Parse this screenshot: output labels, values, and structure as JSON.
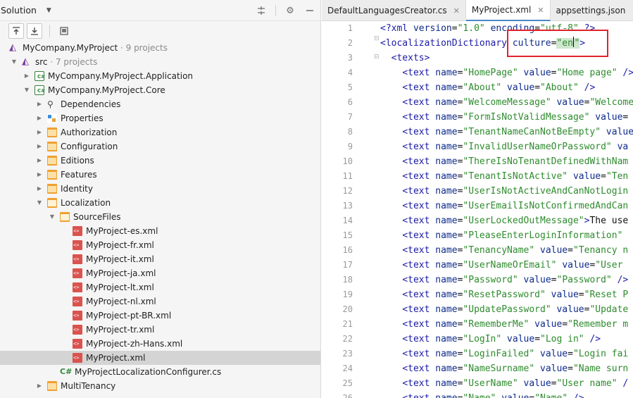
{
  "solution_panel": {
    "title": "Solution",
    "header_icons": [
      "collapse-all-icon",
      "gear-icon",
      "minimize-icon"
    ],
    "toolbar_icons": [
      "sort-up-icon",
      "sort-down-icon",
      "preview-icon"
    ]
  },
  "tree": [
    {
      "label": "MyCompany.MyProject",
      "sub": " · 9 projects",
      "icon": "solution-icon",
      "indent": 0,
      "arrow": ""
    },
    {
      "label": "src",
      "sub": " · 7 projects",
      "icon": "solution-folder-icon",
      "indent": 1,
      "arrow": "down"
    },
    {
      "label": "MyCompany.MyProject.Application",
      "sub": "",
      "icon": "csharp-project-icon",
      "indent": 2,
      "arrow": "right"
    },
    {
      "label": "MyCompany.MyProject.Core",
      "sub": "",
      "icon": "csharp-project-icon",
      "indent": 2,
      "arrow": "down"
    },
    {
      "label": "Dependencies",
      "sub": "",
      "icon": "dependencies-icon",
      "indent": 3,
      "arrow": "right"
    },
    {
      "label": "Properties",
      "sub": "",
      "icon": "properties-icon",
      "indent": 3,
      "arrow": "right"
    },
    {
      "label": "Authorization",
      "sub": "",
      "icon": "folder-icon",
      "indent": 3,
      "arrow": "right"
    },
    {
      "label": "Configuration",
      "sub": "",
      "icon": "folder-icon",
      "indent": 3,
      "arrow": "right"
    },
    {
      "label": "Editions",
      "sub": "",
      "icon": "folder-icon",
      "indent": 3,
      "arrow": "right"
    },
    {
      "label": "Features",
      "sub": "",
      "icon": "folder-icon",
      "indent": 3,
      "arrow": "right"
    },
    {
      "label": "Identity",
      "sub": "",
      "icon": "folder-icon",
      "indent": 3,
      "arrow": "right"
    },
    {
      "label": "Localization",
      "sub": "",
      "icon": "folder-open-icon",
      "indent": 3,
      "arrow": "down"
    },
    {
      "label": "SourceFiles",
      "sub": "",
      "icon": "folder-open-icon",
      "indent": 4,
      "arrow": "down"
    },
    {
      "label": "MyProject-es.xml",
      "sub": "",
      "icon": "xml-file-icon",
      "indent": 5,
      "arrow": ""
    },
    {
      "label": "MyProject-fr.xml",
      "sub": "",
      "icon": "xml-file-icon",
      "indent": 5,
      "arrow": ""
    },
    {
      "label": "MyProject-it.xml",
      "sub": "",
      "icon": "xml-file-icon",
      "indent": 5,
      "arrow": ""
    },
    {
      "label": "MyProject-ja.xml",
      "sub": "",
      "icon": "xml-file-icon",
      "indent": 5,
      "arrow": ""
    },
    {
      "label": "MyProject-lt.xml",
      "sub": "",
      "icon": "xml-file-icon",
      "indent": 5,
      "arrow": ""
    },
    {
      "label": "MyProject-nl.xml",
      "sub": "",
      "icon": "xml-file-icon",
      "indent": 5,
      "arrow": ""
    },
    {
      "label": "MyProject-pt-BR.xml",
      "sub": "",
      "icon": "xml-file-icon",
      "indent": 5,
      "arrow": ""
    },
    {
      "label": "MyProject-tr.xml",
      "sub": "",
      "icon": "xml-file-icon",
      "indent": 5,
      "arrow": ""
    },
    {
      "label": "MyProject-zh-Hans.xml",
      "sub": "",
      "icon": "xml-file-icon",
      "indent": 5,
      "arrow": ""
    },
    {
      "label": "MyProject.xml",
      "sub": "",
      "icon": "xml-file-icon",
      "indent": 5,
      "arrow": "",
      "selected": true
    },
    {
      "label": "MyProjectLocalizationConfigurer.cs",
      "sub": "",
      "icon": "csharp-file-icon",
      "indent": 4,
      "arrow": ""
    },
    {
      "label": "MultiTenancy",
      "sub": "",
      "icon": "folder-icon",
      "indent": 3,
      "arrow": "right"
    }
  ],
  "tabs": [
    {
      "label": "DefaultLanguagesCreator.cs",
      "active": false
    },
    {
      "label": "MyProject.xml",
      "active": true
    },
    {
      "label": "appsettings.json",
      "active": false
    }
  ],
  "code_lines": [
    {
      "n": "1",
      "parts": [
        [
          "tag",
          "<?xml "
        ],
        [
          "attr",
          "version"
        ],
        [
          "txt",
          "="
        ],
        [
          "val",
          "\"1.0\""
        ],
        [
          "txt",
          " "
        ],
        [
          "attr",
          "encoding"
        ],
        [
          "txt",
          "="
        ],
        [
          "val",
          "\"utf-8\""
        ],
        [
          "tag",
          " ?>"
        ]
      ]
    },
    {
      "n": "2",
      "parts": [
        [
          "tag",
          "<localizationDictionary"
        ],
        [
          "txt",
          " "
        ],
        [
          "attr",
          "culture"
        ],
        [
          "txt",
          "="
        ],
        [
          "valhl",
          "\"en"
        ],
        [
          "caret",
          ""
        ],
        [
          "valhl",
          "\""
        ],
        [
          "tag",
          ">"
        ]
      ]
    },
    {
      "n": "3",
      "parts": [
        [
          "txt",
          "  "
        ],
        [
          "tag",
          "<texts>"
        ]
      ]
    },
    {
      "n": "4",
      "parts": [
        [
          "txt",
          "    "
        ],
        [
          "tag",
          "<text "
        ],
        [
          "attr",
          "name"
        ],
        [
          "txt",
          "="
        ],
        [
          "val",
          "\"HomePage\""
        ],
        [
          "txt",
          " "
        ],
        [
          "attr",
          "value"
        ],
        [
          "txt",
          "="
        ],
        [
          "val",
          "\"Home page\""
        ],
        [
          "tag",
          " />"
        ]
      ]
    },
    {
      "n": "5",
      "parts": [
        [
          "txt",
          "    "
        ],
        [
          "tag",
          "<text "
        ],
        [
          "attr",
          "name"
        ],
        [
          "txt",
          "="
        ],
        [
          "val",
          "\"About\""
        ],
        [
          "txt",
          " "
        ],
        [
          "attr",
          "value"
        ],
        [
          "txt",
          "="
        ],
        [
          "val",
          "\"About\""
        ],
        [
          "tag",
          " />"
        ]
      ]
    },
    {
      "n": "6",
      "parts": [
        [
          "txt",
          "    "
        ],
        [
          "tag",
          "<text "
        ],
        [
          "attr",
          "name"
        ],
        [
          "txt",
          "="
        ],
        [
          "val",
          "\"WelcomeMessage\""
        ],
        [
          "txt",
          " "
        ],
        [
          "attr",
          "value"
        ],
        [
          "txt",
          "="
        ],
        [
          "val",
          "\"Welcome"
        ]
      ]
    },
    {
      "n": "7",
      "parts": [
        [
          "txt",
          "    "
        ],
        [
          "tag",
          "<text "
        ],
        [
          "attr",
          "name"
        ],
        [
          "txt",
          "="
        ],
        [
          "val",
          "\"FormIsNotValidMessage\""
        ],
        [
          "txt",
          " "
        ],
        [
          "attr",
          "value"
        ],
        [
          "txt",
          "="
        ]
      ]
    },
    {
      "n": "8",
      "parts": [
        [
          "txt",
          "    "
        ],
        [
          "tag",
          "<text "
        ],
        [
          "attr",
          "name"
        ],
        [
          "txt",
          "="
        ],
        [
          "val",
          "\"TenantNameCanNotBeEmpty\""
        ],
        [
          "txt",
          " "
        ],
        [
          "attr",
          "value"
        ]
      ]
    },
    {
      "n": "9",
      "parts": [
        [
          "txt",
          "    "
        ],
        [
          "tag",
          "<text "
        ],
        [
          "attr",
          "name"
        ],
        [
          "txt",
          "="
        ],
        [
          "val",
          "\"InvalidUserNameOrPassword\""
        ],
        [
          "txt",
          " "
        ],
        [
          "attr",
          "va"
        ]
      ]
    },
    {
      "n": "10",
      "parts": [
        [
          "txt",
          "    "
        ],
        [
          "tag",
          "<text "
        ],
        [
          "attr",
          "name"
        ],
        [
          "txt",
          "="
        ],
        [
          "val",
          "\"ThereIsNoTenantDefinedWithNam"
        ]
      ]
    },
    {
      "n": "11",
      "parts": [
        [
          "txt",
          "    "
        ],
        [
          "tag",
          "<text "
        ],
        [
          "attr",
          "name"
        ],
        [
          "txt",
          "="
        ],
        [
          "val",
          "\"TenantIsNotActive\""
        ],
        [
          "txt",
          " "
        ],
        [
          "attr",
          "value"
        ],
        [
          "txt",
          "="
        ],
        [
          "val",
          "\"Ten"
        ]
      ]
    },
    {
      "n": "12",
      "parts": [
        [
          "txt",
          "    "
        ],
        [
          "tag",
          "<text "
        ],
        [
          "attr",
          "name"
        ],
        [
          "txt",
          "="
        ],
        [
          "val",
          "\"UserIsNotActiveAndCanNotLogin"
        ]
      ]
    },
    {
      "n": "13",
      "parts": [
        [
          "txt",
          "    "
        ],
        [
          "tag",
          "<text "
        ],
        [
          "attr",
          "name"
        ],
        [
          "txt",
          "="
        ],
        [
          "val",
          "\"UserEmailIsNotConfirmedAndCan"
        ]
      ]
    },
    {
      "n": "14",
      "parts": [
        [
          "txt",
          "    "
        ],
        [
          "tag",
          "<text "
        ],
        [
          "attr",
          "name"
        ],
        [
          "txt",
          "="
        ],
        [
          "val",
          "\"UserLockedOutMessage\""
        ],
        [
          "tag",
          ">"
        ],
        [
          "txt",
          "The use"
        ]
      ]
    },
    {
      "n": "15",
      "parts": [
        [
          "txt",
          "    "
        ],
        [
          "tag",
          "<text "
        ],
        [
          "attr",
          "name"
        ],
        [
          "txt",
          "="
        ],
        [
          "val",
          "\"PleaseEnterLoginInformation\""
        ]
      ]
    },
    {
      "n": "16",
      "parts": [
        [
          "txt",
          "    "
        ],
        [
          "tag",
          "<text "
        ],
        [
          "attr",
          "name"
        ],
        [
          "txt",
          "="
        ],
        [
          "val",
          "\"TenancyName\""
        ],
        [
          "txt",
          " "
        ],
        [
          "attr",
          "value"
        ],
        [
          "txt",
          "="
        ],
        [
          "val",
          "\"Tenancy n"
        ]
      ]
    },
    {
      "n": "17",
      "parts": [
        [
          "txt",
          "    "
        ],
        [
          "tag",
          "<text "
        ],
        [
          "attr",
          "name"
        ],
        [
          "txt",
          "="
        ],
        [
          "val",
          "\"UserNameOrEmail\""
        ],
        [
          "txt",
          " "
        ],
        [
          "attr",
          "value"
        ],
        [
          "txt",
          "="
        ],
        [
          "val",
          "\"User "
        ]
      ]
    },
    {
      "n": "18",
      "parts": [
        [
          "txt",
          "    "
        ],
        [
          "tag",
          "<text "
        ],
        [
          "attr",
          "name"
        ],
        [
          "txt",
          "="
        ],
        [
          "val",
          "\"Password\""
        ],
        [
          "txt",
          " "
        ],
        [
          "attr",
          "value"
        ],
        [
          "txt",
          "="
        ],
        [
          "val",
          "\"Password\""
        ],
        [
          "tag",
          " />"
        ]
      ]
    },
    {
      "n": "19",
      "parts": [
        [
          "txt",
          "    "
        ],
        [
          "tag",
          "<text "
        ],
        [
          "attr",
          "name"
        ],
        [
          "txt",
          "="
        ],
        [
          "val",
          "\"ResetPassword\""
        ],
        [
          "txt",
          " "
        ],
        [
          "attr",
          "value"
        ],
        [
          "txt",
          "="
        ],
        [
          "val",
          "\"Reset P"
        ]
      ]
    },
    {
      "n": "20",
      "parts": [
        [
          "txt",
          "    "
        ],
        [
          "tag",
          "<text "
        ],
        [
          "attr",
          "name"
        ],
        [
          "txt",
          "="
        ],
        [
          "val",
          "\"UpdatePassword\""
        ],
        [
          "txt",
          " "
        ],
        [
          "attr",
          "value"
        ],
        [
          "txt",
          "="
        ],
        [
          "val",
          "\"Update"
        ]
      ]
    },
    {
      "n": "21",
      "parts": [
        [
          "txt",
          "    "
        ],
        [
          "tag",
          "<text "
        ],
        [
          "attr",
          "name"
        ],
        [
          "txt",
          "="
        ],
        [
          "val",
          "\"RememberMe\""
        ],
        [
          "txt",
          " "
        ],
        [
          "attr",
          "value"
        ],
        [
          "txt",
          "="
        ],
        [
          "val",
          "\"Remember m"
        ]
      ]
    },
    {
      "n": "22",
      "parts": [
        [
          "txt",
          "    "
        ],
        [
          "tag",
          "<text "
        ],
        [
          "attr",
          "name"
        ],
        [
          "txt",
          "="
        ],
        [
          "val",
          "\"LogIn\""
        ],
        [
          "txt",
          " "
        ],
        [
          "attr",
          "value"
        ],
        [
          "txt",
          "="
        ],
        [
          "val",
          "\"Log in\""
        ],
        [
          "tag",
          " />"
        ]
      ]
    },
    {
      "n": "23",
      "parts": [
        [
          "txt",
          "    "
        ],
        [
          "tag",
          "<text "
        ],
        [
          "attr",
          "name"
        ],
        [
          "txt",
          "="
        ],
        [
          "val",
          "\"LoginFailed\""
        ],
        [
          "txt",
          " "
        ],
        [
          "attr",
          "value"
        ],
        [
          "txt",
          "="
        ],
        [
          "val",
          "\"Login fai"
        ]
      ]
    },
    {
      "n": "24",
      "parts": [
        [
          "txt",
          "    "
        ],
        [
          "tag",
          "<text "
        ],
        [
          "attr",
          "name"
        ],
        [
          "txt",
          "="
        ],
        [
          "val",
          "\"NameSurname\""
        ],
        [
          "txt",
          " "
        ],
        [
          "attr",
          "value"
        ],
        [
          "txt",
          "="
        ],
        [
          "val",
          "\"Name surn"
        ]
      ]
    },
    {
      "n": "25",
      "parts": [
        [
          "txt",
          "    "
        ],
        [
          "tag",
          "<text "
        ],
        [
          "attr",
          "name"
        ],
        [
          "txt",
          "="
        ],
        [
          "val",
          "\"UserName\""
        ],
        [
          "txt",
          " "
        ],
        [
          "attr",
          "value"
        ],
        [
          "txt",
          "="
        ],
        [
          "val",
          "\"User name\""
        ],
        [
          "tag",
          " /"
        ]
      ]
    },
    {
      "n": "26",
      "parts": [
        [
          "txt",
          "    "
        ],
        [
          "tag",
          "<text "
        ],
        [
          "attr",
          "name"
        ],
        [
          "txt",
          "="
        ],
        [
          "val",
          "\"Name\""
        ],
        [
          "txt",
          " "
        ],
        [
          "attr",
          "value"
        ],
        [
          "txt",
          "="
        ],
        [
          "val",
          "\"Name\""
        ],
        [
          "tag",
          " />"
        ]
      ]
    }
  ],
  "colors": {
    "highlight_box": "#e0232b",
    "active_tab_underline": "#4a88c7",
    "selected_row": "#d4d4d4"
  }
}
